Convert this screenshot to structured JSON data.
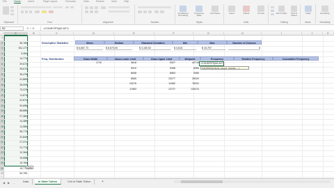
{
  "ribbon": {
    "tabs": [
      "File",
      "Home",
      "Insert",
      "Page Layout",
      "Formulas",
      "Data",
      "Review",
      "View",
      "Help"
    ],
    "active_tab": "Home",
    "groups": [
      "Clipboard",
      "Font",
      "Alignment",
      "Number",
      "Styles",
      "Cells",
      "Editing",
      "Ideas",
      "Sensitivity"
    ],
    "styles_buttons": [
      "Conditional Formatting",
      "Format as Table",
      "Cell Styles"
    ],
    "cells_buttons": [
      "Insert",
      "Delete",
      "Format"
    ],
    "editing_buttons": [
      "Sort & Filter",
      "Find & Select"
    ],
    "ideas_button": "Ideas",
    "sensitivity_button": "Sensitivity"
  },
  "formula_bar": {
    "name_box": "B2",
    "fx_label": "fx",
    "formula": "=COUNTIFS(A2:A27)"
  },
  "grid": {
    "columns": [
      "A",
      "B",
      "C",
      "D",
      "E",
      "F",
      "G",
      "H",
      "I",
      "J",
      "K"
    ],
    "selected_column": "A",
    "rows": [
      "1",
      "2",
      "3",
      "4",
      "5",
      "6",
      "7",
      "8",
      "9",
      "10",
      "11",
      "12",
      "13",
      "14",
      "15",
      "16",
      "17",
      "18",
      "19",
      "20",
      "21",
      "22",
      "23",
      "24",
      "25",
      "26",
      "27"
    ],
    "column_a_values": [
      "36,769",
      "511,177",
      "3,464",
      "14,774",
      "29,672",
      "26,672",
      "35,476",
      "41,869",
      "28,009",
      "73,375",
      "11,874",
      "22,874",
      "94,655",
      "58,889",
      "27,384",
      "14,389",
      "11,580",
      "35,773",
      "22,849",
      "27,371",
      "21,774",
      "12,364",
      "19,558",
      "10,784",
      "15,770",
      "53,755"
    ],
    "descriptive_statistics": {
      "label": "Descriptive Statistics",
      "headers": [
        "Mean",
        "Median",
        "Standard Deviation",
        "Min",
        "Max",
        "Number of Classes"
      ],
      "values": [
        "$ 6,687.73",
        "$ 8,670.00",
        "$ 3,160.52",
        "$ 3,618",
        "$ 15,757",
        "6"
      ]
    },
    "frequency_distribution": {
      "label": "Freq. Distribution",
      "headers": [
        "Class Width",
        "Class Lower Limit",
        "Class Upper Limit",
        "Midpoint",
        "Frequency",
        "Relative Frequency",
        "Cumulative Frequency"
      ],
      "class_width": "1710",
      "lower_limits": [
        "3618",
        "5310",
        "6848",
        "8565",
        "10276",
        "11983"
      ],
      "upper_limits": [
        "5327",
        "5358",
        "8563",
        "10277",
        "11982",
        "13727"
      ],
      "midpoints": [
        "42715",
        "8066",
        "9460",
        "39020",
        "76201",
        "139210"
      ],
      "active_cell_text": "=COUNTIFS(A2:A27,",
      "autocomplete_hint": "COUNTIFS(criteria_range1, criteria1, ...)"
    },
    "paste_tag": "(Ctrl)"
  },
  "sheets": {
    "tabs": [
      "Data",
      "In State Tuition",
      "Ch4 of State Tuition"
    ],
    "active": "In State Tuition",
    "add_label": "+"
  }
}
